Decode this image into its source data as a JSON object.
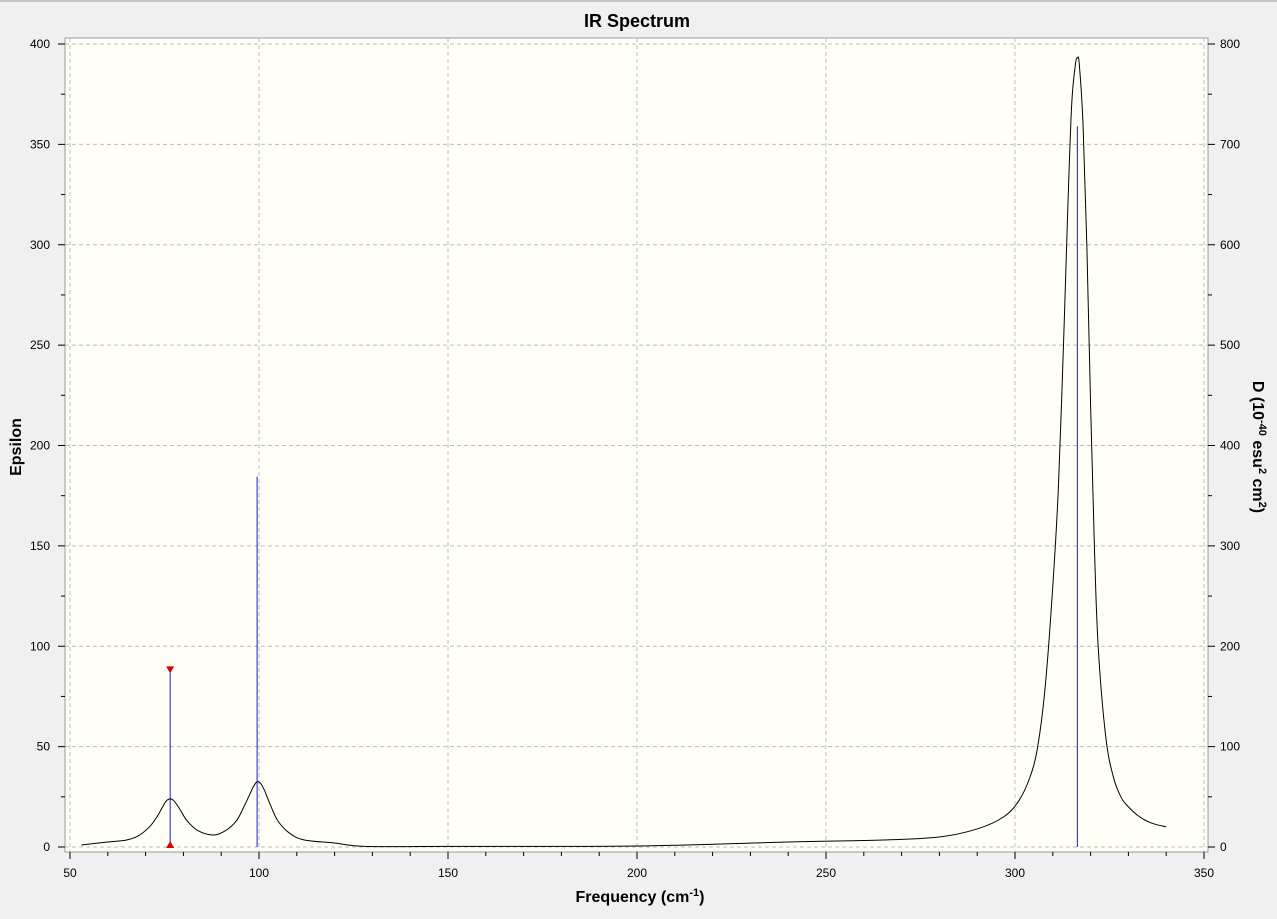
{
  "window": {
    "title": "IR Spectrum"
  },
  "chart_data": {
    "type": "line",
    "title": "IR Spectrum",
    "xlabel": "Frequency (cm",
    "xlabel_sup": "-1",
    "xlabel_end": ")",
    "ylabel_left": "Epsilon",
    "ylabel_right": "D (10",
    "ylabel_right_sup1": "-40",
    "ylabel_right_mid": " esu",
    "ylabel_right_sup2": "2",
    "ylabel_right_mid2": " cm",
    "ylabel_right_sup3": "2",
    "ylabel_right_end": ")",
    "xlim": [
      50,
      350
    ],
    "ylim_left": [
      0,
      400
    ],
    "ylim_right": [
      0,
      800
    ],
    "x_ticks": [
      50,
      100,
      150,
      200,
      250,
      300,
      350
    ],
    "y_ticks_left": [
      0,
      50,
      100,
      150,
      200,
      250,
      300,
      350,
      400
    ],
    "y_ticks_right": [
      0,
      100,
      200,
      300,
      400,
      500,
      600,
      700,
      800
    ],
    "grid": true,
    "colors": {
      "plot_bg": "#fffff7",
      "spectrum": "#000000",
      "sticks": "#1a1acc",
      "marker": "#dd0000",
      "grid": "#bdbdbd"
    },
    "spectrum": {
      "x": [
        53,
        60,
        65,
        68,
        71,
        73,
        74.5,
        75.5,
        76.5,
        77.5,
        79,
        81,
        84,
        88,
        91,
        94,
        96,
        97.5,
        98.5,
        99.5,
        100.5,
        101.5,
        103,
        105,
        108,
        112,
        120,
        128,
        150,
        200,
        240,
        265,
        280,
        290,
        297,
        301,
        304,
        306,
        308,
        310,
        311.5,
        313,
        314,
        315,
        316,
        316.5,
        317,
        318,
        319,
        320,
        321,
        322,
        324,
        326,
        328,
        330,
        333,
        336,
        340
      ],
      "y": [
        1,
        2.5,
        3.5,
        5.5,
        10,
        15,
        20,
        23,
        24,
        23,
        19,
        13,
        8,
        6,
        8,
        13,
        20,
        26,
        30,
        32.5,
        31.5,
        28,
        21,
        13,
        7,
        3.5,
        2,
        0.3,
        0.3,
        0.5,
        2.5,
        3.5,
        5,
        9,
        15,
        23,
        35,
        50,
        80,
        130,
        180,
        260,
        320,
        370,
        390,
        393,
        390,
        360,
        300,
        220,
        150,
        100,
        55,
        35,
        25,
        20,
        15,
        12,
        10
      ]
    },
    "sticks": [
      {
        "x": 76.5,
        "d": 176
      },
      {
        "x": 99.5,
        "d": 369
      },
      {
        "x": 316.5,
        "d": 718
      }
    ],
    "selected_stick_x": 76.5
  }
}
